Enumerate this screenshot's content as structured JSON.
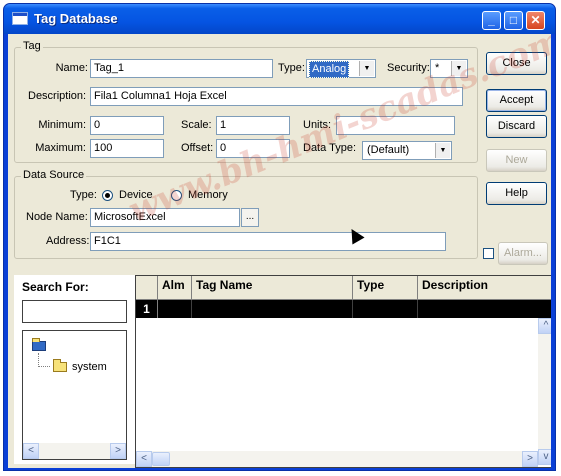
{
  "window": {
    "title": "Tag Database"
  },
  "tag_group": {
    "title": "Tag",
    "name_label": "Name:",
    "name_value": "Tag_1",
    "type_label": "Type:",
    "type_value": "Analog",
    "security_label": "Security:",
    "security_value": "*",
    "description_label": "Description:",
    "description_value": "Fila1 Columna1 Hoja Excel",
    "minimum_label": "Minimum:",
    "minimum_value": "0",
    "scale_label": "Scale:",
    "scale_value": "1",
    "units_label": "Units:",
    "units_value": "",
    "maximum_label": "Maximum:",
    "maximum_value": "100",
    "offset_label": "Offset:",
    "offset_value": "0",
    "datatype_label": "Data Type:",
    "datatype_value": "(Default)"
  },
  "datasource_group": {
    "title": "Data Source",
    "type_label": "Type:",
    "option_device": "Device",
    "option_memory": "Memory",
    "selected": "Device",
    "node_label": "Node Name:",
    "node_value": "MicrosoftExcel",
    "browse_label": "...",
    "address_label": "Address:",
    "address_value": "F1C1"
  },
  "buttons": {
    "close": "Close",
    "accept": "Accept",
    "discard": "Discard",
    "new": "New",
    "help": "Help",
    "alarm": "Alarm..."
  },
  "search": {
    "label": "Search For:",
    "value": "",
    "tree_child": "system"
  },
  "grid": {
    "columns": [
      "Alm",
      "Tag Name",
      "Type",
      "Description"
    ],
    "rows": [
      {
        "num": "1",
        "alm": "",
        "tag_name": "",
        "type": "",
        "description": ""
      }
    ]
  },
  "watermark": "www.bh-hmi-scadas.com",
  "colors": {
    "titlebar": "#0554e2",
    "client": "#ece9d8",
    "selection": "#316ac5"
  }
}
